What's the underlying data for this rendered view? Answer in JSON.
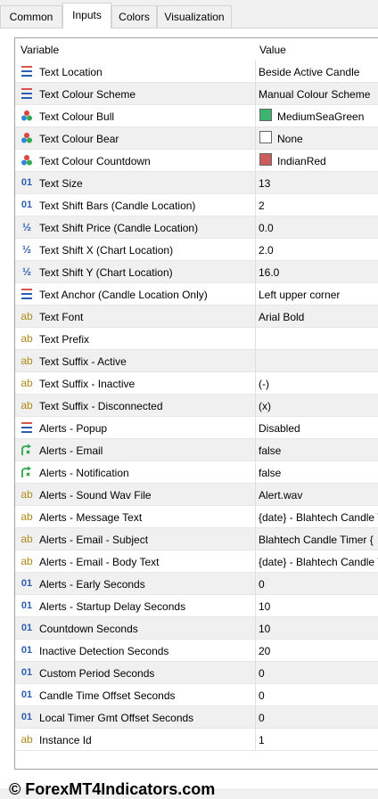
{
  "tabs": [
    {
      "label": "Common"
    },
    {
      "label": "Inputs"
    },
    {
      "label": "Colors"
    },
    {
      "label": "Visualization"
    }
  ],
  "grid": {
    "header_variable": "Variable",
    "header_value": "Value",
    "rows": [
      {
        "icon": "list-icon",
        "name": "Text Location",
        "value": "Beside Active Candle"
      },
      {
        "icon": "list-icon",
        "name": "Text Colour Scheme",
        "value": "Manual Colour Scheme"
      },
      {
        "icon": "color-icon",
        "name": "Text Colour Bull",
        "value": "MediumSeaGreen",
        "swatch": "#3cb371"
      },
      {
        "icon": "color-icon",
        "name": "Text Colour Bear",
        "value": "None",
        "swatch": "#ffffff"
      },
      {
        "icon": "color-icon",
        "name": "Text Colour Countdown",
        "value": "IndianRed",
        "swatch": "#cd5c5c"
      },
      {
        "icon": "integer-icon",
        "name": "Text Size",
        "value": "13"
      },
      {
        "icon": "integer-icon",
        "name": "Text Shift Bars  (Candle Location)",
        "value": "2"
      },
      {
        "icon": "double-icon",
        "name": "Text Shift Price (Candle Location)",
        "value": "0.0"
      },
      {
        "icon": "double-icon",
        "name": "Text Shift X (Chart Location)",
        "value": "2.0"
      },
      {
        "icon": "double-icon",
        "name": "Text Shift Y (Chart Location)",
        "value": "16.0"
      },
      {
        "icon": "list-icon",
        "name": "Text Anchor (Candle Location Only)",
        "value": "Left upper corner"
      },
      {
        "icon": "string-icon",
        "name": "Text Font",
        "value": "Arial Bold"
      },
      {
        "icon": "string-icon",
        "name": "Text Prefix",
        "value": ""
      },
      {
        "icon": "string-icon",
        "name": "Text Suffix - Active",
        "value": ""
      },
      {
        "icon": "string-icon",
        "name": "Text Suffix - Inactive",
        "value": "(-)"
      },
      {
        "icon": "string-icon",
        "name": "Text Suffix - Disconnected",
        "value": "(x)"
      },
      {
        "icon": "list-icon",
        "name": "Alerts - Popup",
        "value": "Disabled"
      },
      {
        "icon": "bool-icon",
        "name": "Alerts - Email",
        "value": "false"
      },
      {
        "icon": "bool-icon",
        "name": "Alerts - Notification",
        "value": "false"
      },
      {
        "icon": "string-icon",
        "name": "Alerts - Sound Wav File",
        "value": "Alert.wav"
      },
      {
        "icon": "string-icon",
        "name": "Alerts - Message Text",
        "value": "{date} - Blahtech Candle Ti"
      },
      {
        "icon": "string-icon",
        "name": "Alerts - Email - Subject",
        "value": "Blahtech Candle Timer {"
      },
      {
        "icon": "string-icon",
        "name": "Alerts - Email - Body Text",
        "value": "{date} - Blahtech Candle Ti"
      },
      {
        "icon": "integer-icon",
        "name": "Alerts - Early Seconds",
        "value": "0"
      },
      {
        "icon": "integer-icon",
        "name": "Alerts - Startup Delay Seconds",
        "value": "10"
      },
      {
        "icon": "integer-icon",
        "name": "Countdown Seconds",
        "value": "10"
      },
      {
        "icon": "integer-icon",
        "name": "Inactive Detection Seconds",
        "value": "20"
      },
      {
        "icon": "integer-icon",
        "name": "Custom Period Seconds",
        "value": "0"
      },
      {
        "icon": "integer-icon",
        "name": "Candle Time Offset Seconds",
        "value": "0"
      },
      {
        "icon": "integer-icon",
        "name": "Local Timer Gmt Offset Seconds",
        "value": "0"
      },
      {
        "icon": "string-icon",
        "name": "Instance Id",
        "value": "1"
      }
    ]
  },
  "footer": "© ForexMT4Indicators.com"
}
